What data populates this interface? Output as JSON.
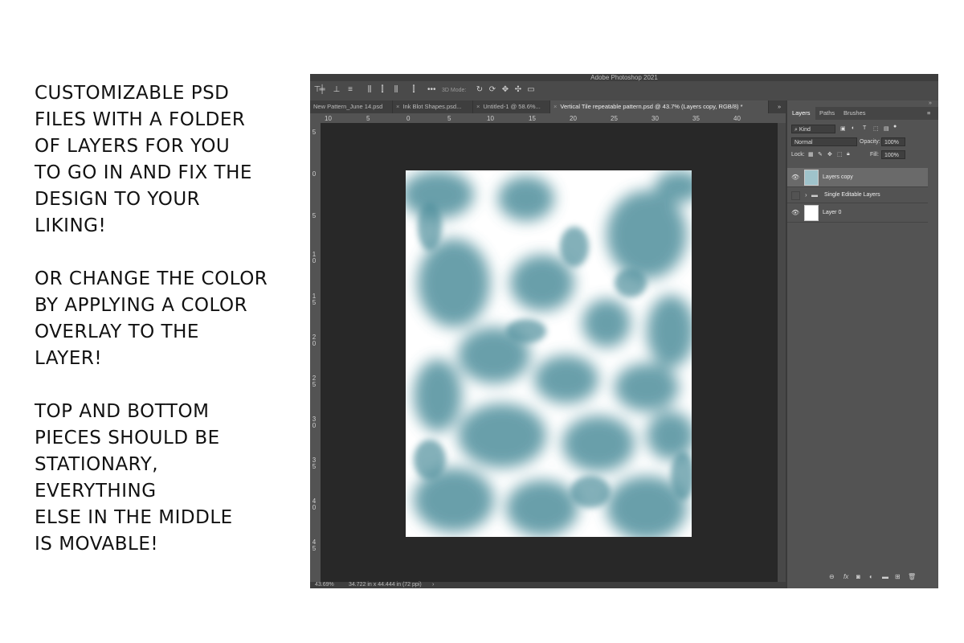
{
  "promo": {
    "paragraph1": "CUSTOMIZABLE PSD\nFILES WITH A FOLDER\nOF LAYERS FOR YOU\nTO GO IN AND FIX THE\nDESIGN TO YOUR\nLIKING!",
    "paragraph2": "OR CHANGE THE COLOR\nBY APPLYING A COLOR\nOVERLAY TO THE\nLAYER!",
    "paragraph3": "TOP AND BOTTOM\nPIECES SHOULD BE\nSTATIONARY,\nEVERYTHING\nELSE IN THE MIDDLE\nIS MOVABLE!"
  },
  "app": {
    "title": "Adobe Photoshop 2021"
  },
  "options_bar": {
    "mode_label": "3D Mode:"
  },
  "tabs": [
    {
      "label": "New Pattern_June 14.psd",
      "close": "×"
    },
    {
      "label": "Ink Blot Shapes.psd...",
      "close": "×"
    },
    {
      "label": "Untitled-1 @ 58.6%...",
      "close": "×"
    },
    {
      "label": "Vertical Tile repeatable pattern.psd @ 43.7% (Layers copy, RGB/8) *",
      "close": "×"
    }
  ],
  "ruler_top": [
    "10",
    "5",
    "0",
    "5",
    "10",
    "15",
    "20",
    "25",
    "30",
    "35",
    "40"
  ],
  "ruler_left": [
    "5",
    "0",
    "5",
    "1\n0",
    "1\n5",
    "2\n0",
    "2\n5",
    "3\n0",
    "3\n5",
    "4\n0",
    "4\n5"
  ],
  "status": {
    "zoom": "43.69%",
    "size": "34.722 in x 44.444 in (72 ppi)",
    "arrow": "›"
  },
  "layers_panel": {
    "tabs": [
      "Layers",
      "Paths",
      "Brushes"
    ],
    "filter_label": "Kind",
    "blend_mode": "Normal",
    "opacity_label": "Opacity:",
    "opacity_value": "100%",
    "lock_label": "Lock:",
    "fill_label": "Fill:",
    "fill_value": "100%",
    "layers": [
      {
        "name": "Layers copy",
        "selected": true
      },
      {
        "name": "Single Editable Layers",
        "type": "folder"
      },
      {
        "name": "Layer 0"
      }
    ],
    "footer_icons": [
      "link-icon",
      "fx-icon",
      "mask-icon",
      "adjustment-icon",
      "folder-icon",
      "new-layer-icon",
      "trash-icon"
    ]
  },
  "colors": {
    "pattern_teal": "#4f8f9c",
    "canvas_bg": "#282828",
    "panel_bg": "#535353"
  }
}
